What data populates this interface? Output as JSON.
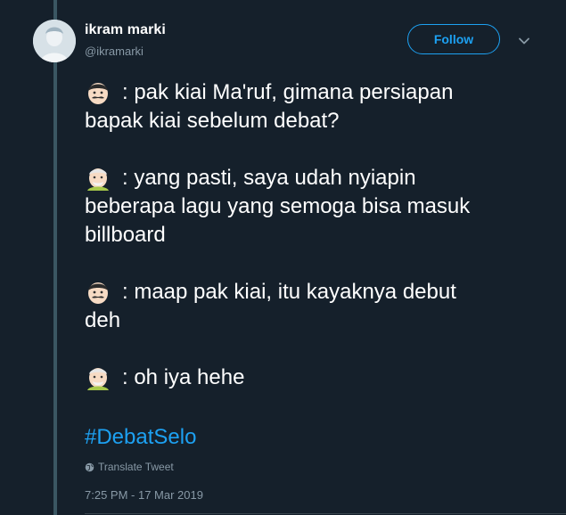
{
  "author": {
    "name": "ikram marki",
    "handle": "@ikramarki"
  },
  "follow_button": {
    "label": "Follow"
  },
  "tweet": {
    "lines": [
      {
        "speaker_icon": "man-with-mustache-emoji",
        "text": ": pak kiai Ma'ruf, gimana persiapan",
        "continuation": "bapak kiai sebelum debat?"
      },
      {
        "speaker_icon": "older-man-emoji",
        "text": ": yang pasti, saya udah nyiapin",
        "continuation": "beberapa lagu yang semoga bisa masuk",
        "continuation2": "billboard"
      },
      {
        "speaker_icon": "man-with-mustache-emoji",
        "text": ": maap pak kiai, itu kayaknya debut",
        "continuation": "deh"
      },
      {
        "speaker_icon": "older-man-emoji",
        "text": ": oh iya hehe"
      }
    ],
    "hashtag": "#DebatSelo",
    "translate_label": "Translate Tweet",
    "timestamp": "7:25 PM - 17 Mar 2019"
  },
  "colors": {
    "background": "#15202b",
    "accent": "#1da1f2",
    "muted": "#8899a6",
    "thread_line": "#3b5763"
  }
}
